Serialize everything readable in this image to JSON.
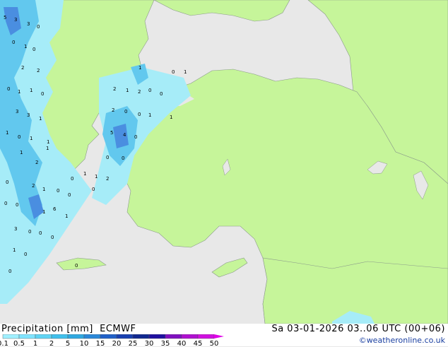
{
  "header": {
    "product": "Precipitation [mm]",
    "model": "ECMWF",
    "valid_time": "Sa 03-01-2026 03..06 UTC (00+06)",
    "credit": "©weatheronline.co.uk"
  },
  "legend": {
    "ticks": [
      "0.1",
      "0.5",
      "1",
      "2",
      "5",
      "10",
      "15",
      "20",
      "25",
      "30",
      "35",
      "40",
      "45",
      "50"
    ],
    "colors": [
      "#a0f0ff",
      "#80e4ff",
      "#60d4f4",
      "#40c0ec",
      "#30a8e0",
      "#2a88d8",
      "#2060c8",
      "#1840b0",
      "#102890",
      "#2010a0",
      "#8010c0",
      "#b010d0",
      "#d010e0",
      "#e000e8"
    ]
  },
  "map": {
    "land_color": "#c6f59a",
    "sea_color": "#e8e8e8",
    "precip_values": [
      "5",
      "3",
      "3",
      "0",
      "2",
      "0",
      "1",
      "0",
      "2",
      "0",
      "1",
      "1",
      "0",
      "3",
      "3",
      "1",
      "1",
      "0",
      "1",
      "1",
      "2",
      "1",
      "1",
      "2",
      "1",
      "2",
      "0",
      "0",
      "1",
      "0",
      "5",
      "4",
      "0",
      "0",
      "2",
      "0",
      "1",
      "1",
      "0",
      "2",
      "1",
      "0",
      "0",
      "1",
      "1",
      "2",
      "0",
      "0",
      "0",
      "0",
      "1",
      "6",
      "1",
      "0",
      "3",
      "0",
      "0",
      "1",
      "0",
      "0",
      "0",
      "1",
      "0",
      "0"
    ]
  },
  "colors": {
    "precip_light": "#a6ecf8",
    "precip_mid": "#62c8ee",
    "precip_heavy": "#4a8ee0",
    "border": "#7a9a9a"
  }
}
